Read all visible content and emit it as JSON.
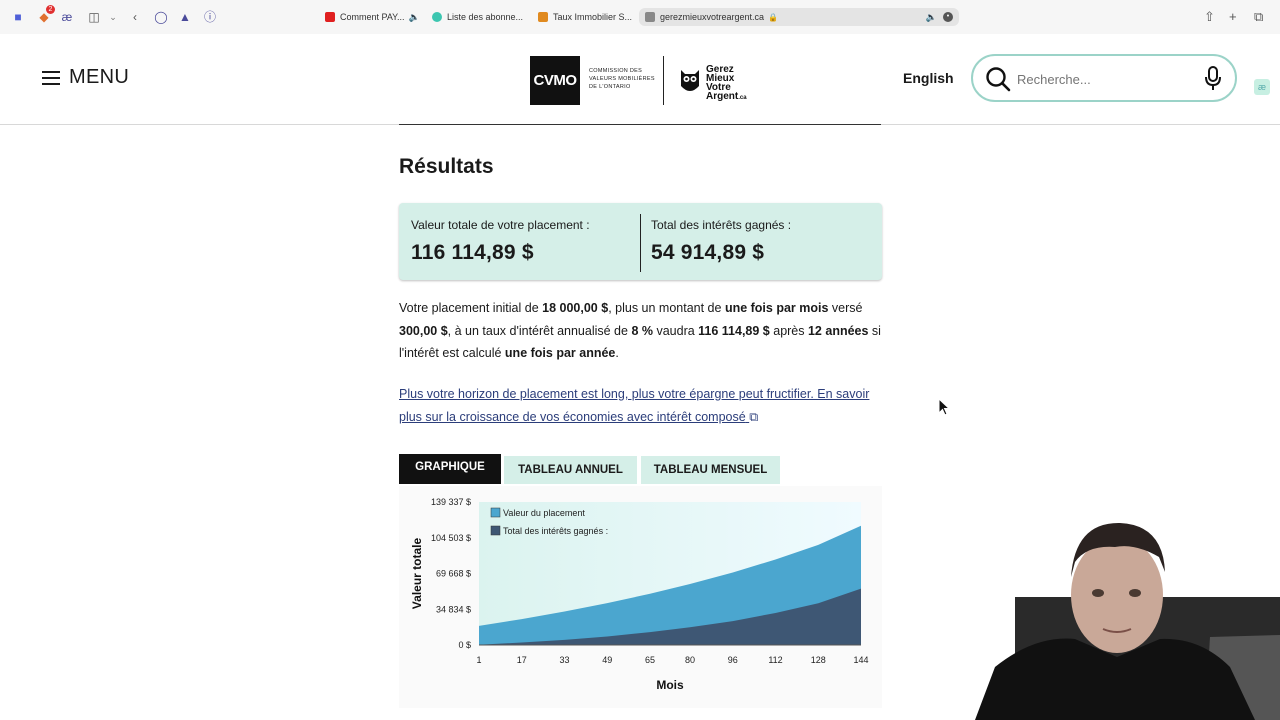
{
  "browser": {
    "tabs": [
      {
        "label": "Comment PAY...",
        "favicon_color": "#e02020"
      },
      {
        "label": "Liste des abonne...",
        "favicon_color": "#3cc6b0"
      },
      {
        "label": "Taux Immobilier S...",
        "favicon_color": "#e08a20"
      },
      {
        "label": "gerezmieuxvotreargent.ca",
        "favicon_color": "#666666"
      }
    ],
    "notification_count": "2"
  },
  "header": {
    "menu_label": "MENU",
    "cvmo_logo": "CVMO",
    "cvmo_text_line1": "COMMISSION DES",
    "cvmo_text_line2": "VALEURS MOBILIÈRES",
    "cvmo_text_line3": "DE L'ONTARIO",
    "gmva_line1": "Gerez",
    "gmva_line2": "Mieux",
    "gmva_line3": "Votre",
    "gmva_line4": "Argent",
    "gmva_suffix": ".ca",
    "language_link": "English",
    "search_placeholder": "Recherche...",
    "ae_badge": "æ"
  },
  "results": {
    "title": "Résultats",
    "total_value_label": "Valeur totale de votre placement :",
    "total_value": "116 114,89 $",
    "interest_label": "Total des intérêts gagnés :",
    "interest_value": "54 914,89 $"
  },
  "summary": {
    "t1": "Votre placement initial de ",
    "initial": "18 000,00 $",
    "t2": ", plus un montant de ",
    "frequency": "une fois par mois",
    "t3": " versé ",
    "contribution": "300,00 $",
    "t4": ", à un taux d'intérêt annualisé de ",
    "rate": "8 %",
    "t5": " vaudra ",
    "final": "116 114,89 $",
    "t6": " après ",
    "years": "12 années",
    "t7": " si l'intérêt est calculé ",
    "compounding": "une fois par année",
    "t8": "."
  },
  "link_text": "Plus votre horizon de placement est long, plus votre épargne peut fructifier. En savoir plus sur la croissance de vos économies avec intérêt composé",
  "chart_tabs": {
    "graph": "GRAPHIQUE",
    "annual": "TABLEAU ANNUEL",
    "monthly": "TABLEAU MENSUEL"
  },
  "chart_data": {
    "type": "area",
    "xlabel": "Mois",
    "ylabel": "Valeur totale",
    "x_ticks": [
      "1",
      "17",
      "33",
      "49",
      "65",
      "80",
      "96",
      "112",
      "128",
      "144"
    ],
    "y_ticks": [
      "0 $",
      "34 834 $",
      "69 668 $",
      "104 503 $",
      "139 337 $"
    ],
    "ylim": [
      0,
      139337
    ],
    "xlim": [
      1,
      144
    ],
    "legend_position": "top-left",
    "series": [
      {
        "name": "Valeur du placement",
        "color": "#4ba6cf",
        "x": [
          1,
          17,
          33,
          49,
          65,
          80,
          96,
          112,
          128,
          144
        ],
        "values": [
          18600,
          25200,
          32600,
          40800,
          49900,
          59400,
          70600,
          83300,
          97500,
          116115
        ]
      },
      {
        "name": "Total des intérêts gagnés :",
        "color": "#3e5774",
        "x": [
          1,
          17,
          33,
          49,
          65,
          80,
          96,
          112,
          128,
          144
        ],
        "values": [
          300,
          2400,
          5000,
          8300,
          12600,
          17200,
          23300,
          31200,
          40700,
          54915
        ]
      }
    ]
  }
}
